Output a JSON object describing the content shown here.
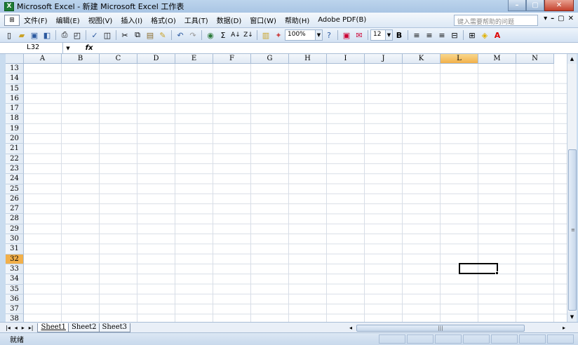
{
  "window": {
    "title": "Microsoft Excel - 新建 Microsoft Excel 工作表",
    "app_icon": "X",
    "controls": {
      "minimize": "–",
      "maximize": "▢",
      "close": "✕"
    }
  },
  "menu": {
    "items": [
      "文件(F)",
      "编辑(E)",
      "视图(V)",
      "插入(I)",
      "格式(O)",
      "工具(T)",
      "数据(D)",
      "窗口(W)",
      "帮助(H)",
      "Adobe PDF(B)"
    ],
    "help_placeholder": "键入需要帮助的问题",
    "mdi_controls": [
      "▾",
      "–",
      "▢",
      "✕"
    ]
  },
  "toolbar": {
    "zoom": "100%",
    "font_size": "12",
    "bold_label": "B"
  },
  "formula_bar": {
    "name_box": "L32",
    "fx_label": "fx",
    "formula": ""
  },
  "grid": {
    "columns": [
      "A",
      "B",
      "C",
      "D",
      "E",
      "F",
      "G",
      "H",
      "I",
      "J",
      "K",
      "L",
      "M",
      "N"
    ],
    "active_column": "L",
    "rows": [
      "13",
      "14",
      "15",
      "16",
      "17",
      "18",
      "19",
      "20",
      "21",
      "22",
      "23",
      "24",
      "25",
      "26",
      "27",
      "28",
      "29",
      "30",
      "31",
      "32",
      "33",
      "34",
      "35",
      "36",
      "37",
      "38"
    ],
    "active_row": "32"
  },
  "sheets": {
    "tabs": [
      "Sheet1",
      "Sheet2",
      "Sheet3"
    ],
    "active": "Sheet1",
    "nav": [
      "|◂",
      "◂",
      "▸",
      "▸|"
    ]
  },
  "status": {
    "text": "就绪"
  }
}
